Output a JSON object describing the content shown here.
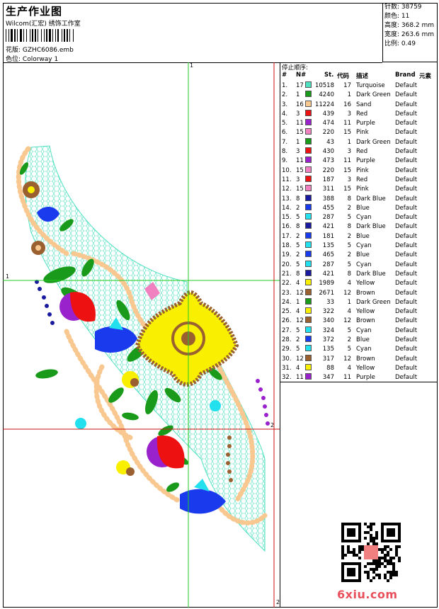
{
  "header": {
    "title": "生产作业图",
    "company": "Wilcom(汇宏) 绣饰工作室",
    "design_label": "花版:",
    "design_value": "GZHC6086.emb",
    "colorway_label": "色位:",
    "colorway_value": "Colorway 1"
  },
  "info": {
    "stitches": "针数: 38759",
    "colors": "颜色: 11",
    "height": "高度: 368.2 mm",
    "width": "宽度: 263.6 mm",
    "scale": "比例: 0.49"
  },
  "axis_labels": {
    "top": "1",
    "left": "1",
    "right": "2",
    "bottom": "2"
  },
  "panel": {
    "title": "停止顺序:",
    "columns": [
      "#",
      "N#",
      "St.",
      "代码",
      "描述",
      "Brand",
      "元素"
    ]
  },
  "rows": [
    {
      "i": "1.",
      "n": "17",
      "c": "#4fe0c0",
      "st": "10518",
      "code": "17",
      "desc": "Turquoise",
      "brand": "Default"
    },
    {
      "i": "2.",
      "n": "1",
      "c": "#1a9a1a",
      "st": "4240",
      "code": "1",
      "desc": "Dark Green",
      "brand": "Default"
    },
    {
      "i": "3.",
      "n": "16",
      "c": "#f8c890",
      "st": "11224",
      "code": "16",
      "desc": "Sand",
      "brand": "Default"
    },
    {
      "i": "4.",
      "n": "3",
      "c": "#ee1111",
      "st": "439",
      "code": "3",
      "desc": "Red",
      "brand": "Default"
    },
    {
      "i": "5.",
      "n": "11",
      "c": "#9922cc",
      "st": "474",
      "code": "11",
      "desc": "Purple",
      "brand": "Default"
    },
    {
      "i": "6.",
      "n": "15",
      "c": "#f080c0",
      "st": "220",
      "code": "15",
      "desc": "Pink",
      "brand": "Default"
    },
    {
      "i": "7.",
      "n": "1",
      "c": "#1a9a1a",
      "st": "43",
      "code": "1",
      "desc": "Dark Green",
      "brand": "Default"
    },
    {
      "i": "8.",
      "n": "3",
      "c": "#ee1111",
      "st": "430",
      "code": "3",
      "desc": "Red",
      "brand": "Default"
    },
    {
      "i": "9.",
      "n": "11",
      "c": "#9922cc",
      "st": "473",
      "code": "11",
      "desc": "Purple",
      "brand": "Default"
    },
    {
      "i": "10.",
      "n": "15",
      "c": "#f080c0",
      "st": "220",
      "code": "15",
      "desc": "Pink",
      "brand": "Default"
    },
    {
      "i": "11.",
      "n": "3",
      "c": "#ee1111",
      "st": "187",
      "code": "3",
      "desc": "Red",
      "brand": "Default"
    },
    {
      "i": "12.",
      "n": "15",
      "c": "#f080c0",
      "st": "311",
      "code": "15",
      "desc": "Pink",
      "brand": "Default"
    },
    {
      "i": "13.",
      "n": "8",
      "c": "#1a1aa0",
      "st": "388",
      "code": "8",
      "desc": "Dark Blue",
      "brand": "Default"
    },
    {
      "i": "14.",
      "n": "2",
      "c": "#1a3aee",
      "st": "455",
      "code": "2",
      "desc": "Blue",
      "brand": "Default"
    },
    {
      "i": "15.",
      "n": "5",
      "c": "#22e0ee",
      "st": "287",
      "code": "5",
      "desc": "Cyan",
      "brand": "Default"
    },
    {
      "i": "16.",
      "n": "8",
      "c": "#1a1aa0",
      "st": "421",
      "code": "8",
      "desc": "Dark Blue",
      "brand": "Default"
    },
    {
      "i": "17.",
      "n": "2",
      "c": "#1a3aee",
      "st": "181",
      "code": "2",
      "desc": "Blue",
      "brand": "Default"
    },
    {
      "i": "18.",
      "n": "5",
      "c": "#22e0ee",
      "st": "135",
      "code": "5",
      "desc": "Cyan",
      "brand": "Default"
    },
    {
      "i": "19.",
      "n": "2",
      "c": "#1a3aee",
      "st": "465",
      "code": "2",
      "desc": "Blue",
      "brand": "Default"
    },
    {
      "i": "20.",
      "n": "5",
      "c": "#22e0ee",
      "st": "287",
      "code": "5",
      "desc": "Cyan",
      "brand": "Default"
    },
    {
      "i": "21.",
      "n": "8",
      "c": "#1a1aa0",
      "st": "421",
      "code": "8",
      "desc": "Dark Blue",
      "brand": "Default"
    },
    {
      "i": "22.",
      "n": "4",
      "c": "#f8f000",
      "st": "1989",
      "code": "4",
      "desc": "Yellow",
      "brand": "Default"
    },
    {
      "i": "23.",
      "n": "12",
      "c": "#9a6030",
      "st": "2671",
      "code": "12",
      "desc": "Brown",
      "brand": "Default"
    },
    {
      "i": "24.",
      "n": "1",
      "c": "#1a9a1a",
      "st": "33",
      "code": "1",
      "desc": "Dark Green",
      "brand": "Default"
    },
    {
      "i": "25.",
      "n": "4",
      "c": "#f8f000",
      "st": "322",
      "code": "4",
      "desc": "Yellow",
      "brand": "Default"
    },
    {
      "i": "26.",
      "n": "12",
      "c": "#9a6030",
      "st": "340",
      "code": "12",
      "desc": "Brown",
      "brand": "Default"
    },
    {
      "i": "27.",
      "n": "5",
      "c": "#22e0ee",
      "st": "324",
      "code": "5",
      "desc": "Cyan",
      "brand": "Default"
    },
    {
      "i": "28.",
      "n": "2",
      "c": "#1a3aee",
      "st": "372",
      "code": "2",
      "desc": "Blue",
      "brand": "Default"
    },
    {
      "i": "29.",
      "n": "5",
      "c": "#22e0ee",
      "st": "135",
      "code": "5",
      "desc": "Cyan",
      "brand": "Default"
    },
    {
      "i": "30.",
      "n": "12",
      "c": "#9a6030",
      "st": "317",
      "code": "12",
      "desc": "Brown",
      "brand": "Default"
    },
    {
      "i": "31.",
      "n": "4",
      "c": "#f8f000",
      "st": "88",
      "code": "4",
      "desc": "Yellow",
      "brand": "Default"
    },
    {
      "i": "32.",
      "n": "11",
      "c": "#9922cc",
      "st": "347",
      "code": "11",
      "desc": "Purple",
      "brand": "Default"
    }
  ],
  "watermark": "6xiu.com",
  "guide_colors": {
    "green": "#22cc22",
    "red": "#cc1111"
  }
}
